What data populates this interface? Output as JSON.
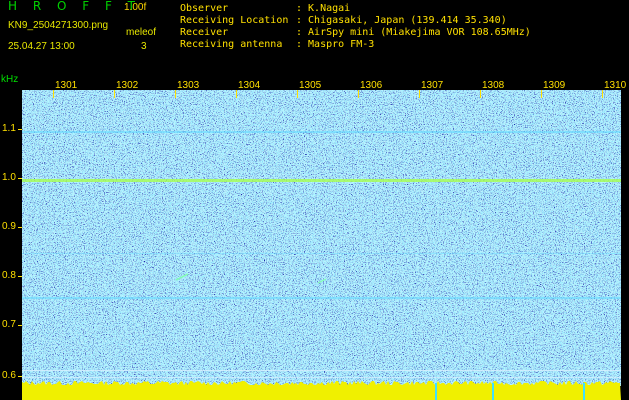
{
  "header": {
    "app_title": "H R O F F T",
    "version": "1.00f",
    "filename": "KN9_2504271300.png",
    "mode": "meleof",
    "datetime": "25.04.27 13:00",
    "number": "3",
    "info": [
      {
        "label": "Observer",
        "value": ": K.Nagai"
      },
      {
        "label": "Receiving Location",
        "value": ": Chigasaki, Japan (139.414 35.340)"
      },
      {
        "label": "Receiver",
        "value": ": AirSpy mini (Miakejima VOR 108.65MHz)"
      },
      {
        "label": "Receiving antenna",
        "value": ": Maspro FM-3"
      }
    ]
  },
  "axes": {
    "y_unit": "kHz",
    "x_ticks": [
      "1301",
      "1302",
      "1303",
      "1304",
      "1305",
      "1306",
      "1307",
      "1308",
      "1309",
      "1310"
    ],
    "y_ticks": [
      "1.1",
      "1.0",
      "0.9",
      "0.8",
      "0.7",
      "0.6"
    ]
  },
  "colors": {
    "background": "#1a1fa8",
    "noise_cyan": "#4fd4ff",
    "carrier": "#a8ff50",
    "baseline": "#f0f000",
    "label_yellow": "#ffe000",
    "title_green": "#00d000"
  }
}
